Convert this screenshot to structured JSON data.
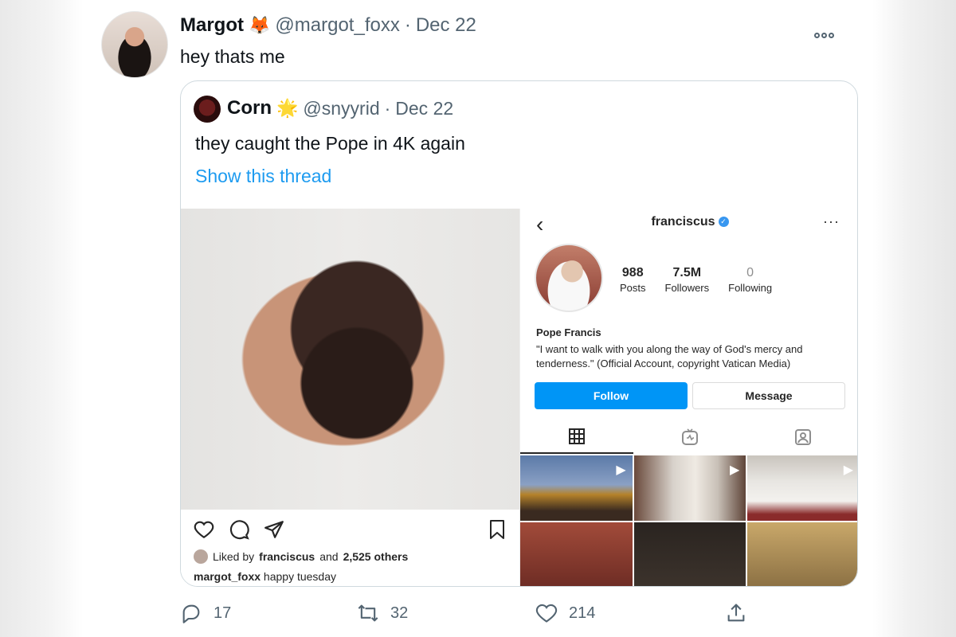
{
  "tweet": {
    "name": "Margot",
    "emoji": "🦊",
    "handle": "@margot_foxx",
    "separator": "·",
    "date": "Dec 22",
    "text": "hey thats me"
  },
  "quote": {
    "name": "Corn",
    "emoji": "🌟",
    "handle": "@snyyrid",
    "separator": "·",
    "date": "Dec 22",
    "text": "they caught the Pope in 4K again",
    "thread_link": "Show this thread"
  },
  "instagram_post": {
    "liked_by_prefix": "Liked by",
    "liked_by_user": "franciscus",
    "liked_by_and": "and",
    "liked_by_count": "2,525 others",
    "caption_user": "margot_foxx",
    "caption_text": "happy tuesday"
  },
  "instagram_profile": {
    "back": "‹",
    "username": "franciscus",
    "more": "···",
    "stats": [
      {
        "value": "988",
        "label": "Posts"
      },
      {
        "value": "7.5M",
        "label": "Followers"
      },
      {
        "value": "0",
        "label": "Following"
      }
    ],
    "display_name": "Pope Francis",
    "bio": "\"I want to walk with you along the way of God's mercy and tenderness.\" (Official Account, copyright Vatican Media)",
    "follow_label": "Follow",
    "message_label": "Message"
  },
  "actions": {
    "replies": "17",
    "retweets": "32",
    "likes": "214"
  },
  "colors": {
    "accent": "#1d9bf0",
    "ig_blue": "#0095f6",
    "muted": "#536471"
  }
}
